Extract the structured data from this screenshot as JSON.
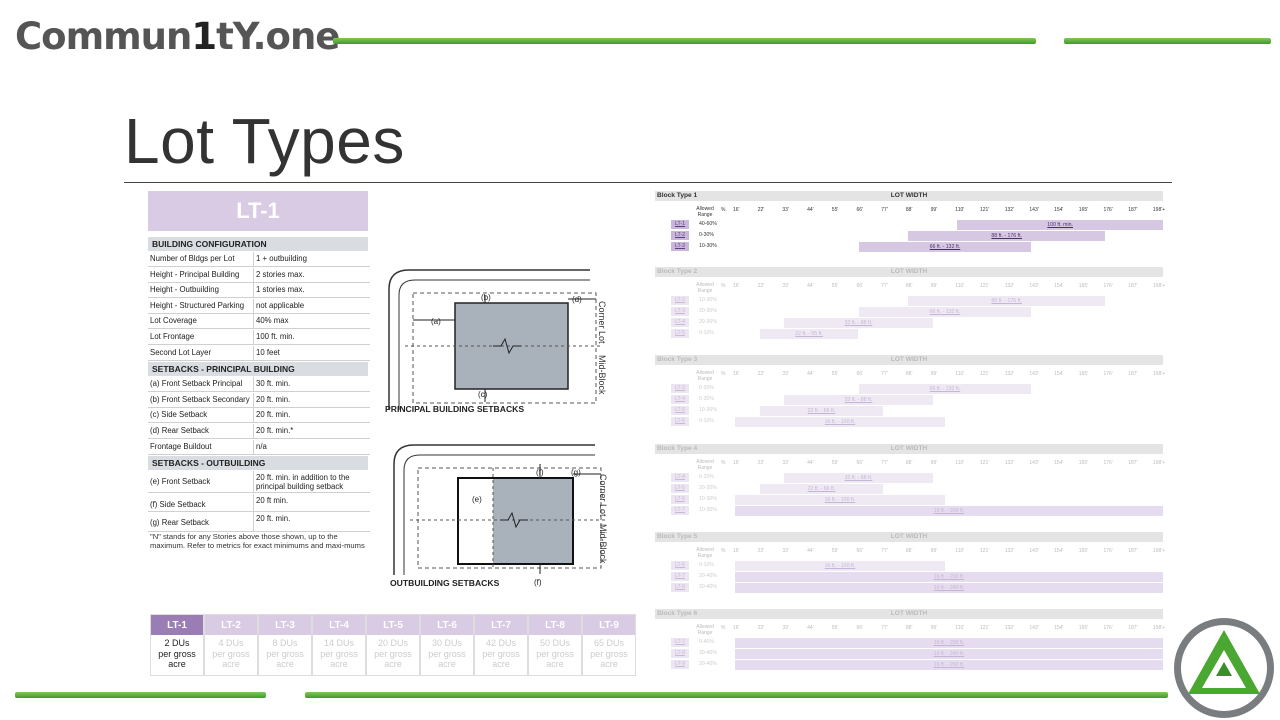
{
  "header": {
    "logo_text_a": "Commun",
    "logo_text_b": "1",
    "logo_text_c": "tY.one",
    "title": "Lot Types"
  },
  "colors": {
    "accent_green": "#4aa832",
    "lavender": "#d9cbe3",
    "purple": "#9b7db5",
    "section_gray": "#d9dde2"
  },
  "lot_table": {
    "title": "LT-1",
    "building_config": {
      "heading": "BUILDING CONFIGURATION",
      "rows": [
        {
          "k": "Number of Bldgs per Lot",
          "v": "1 + outbuilding"
        },
        {
          "k": "Height - Principal Building",
          "v": "2 stories max."
        },
        {
          "k": "Height - Outbuilding",
          "v": "1 stories max."
        },
        {
          "k": "Height - Structured Parking",
          "v": "not applicable"
        },
        {
          "k": "Lot Coverage",
          "v": "40% max"
        },
        {
          "k": "Lot Frontage",
          "v": "100 ft. min."
        },
        {
          "k": "Second Lot Layer",
          "v": "10 feet"
        }
      ]
    },
    "setbacks_principal": {
      "heading": "SETBACKS - PRINCIPAL BUILDING",
      "rows": [
        {
          "k": "(a) Front Setback Principal",
          "v": "30 ft. min."
        },
        {
          "k": "(b) Front Setback Secondary",
          "v": "20 ft. min."
        },
        {
          "k": "(c) Side Setback",
          "v": "20 ft. min."
        },
        {
          "k": "(d) Rear Setback",
          "v": "20 ft. min.*"
        },
        {
          "k": "Frontage Buildout",
          "v": "n/a"
        }
      ]
    },
    "setbacks_outbuilding": {
      "heading": "SETBACKS - OUTBUILDING",
      "rows": [
        {
          "k": "(e) Front Setback",
          "v": "20 ft. min. in addition to the principal building setback"
        },
        {
          "k": "(f) Side Setback",
          "v": "20 ft min."
        },
        {
          "k": "(g) Rear Setback",
          "v": "20 ft. min."
        }
      ]
    },
    "note": "\"N\" stands for any Stories above those shown, up to the maximum. Refer to metrics for exact minimums and maxi-mums"
  },
  "diagrams": {
    "principal": {
      "caption": "PRINCIPAL BUILDING SETBACKS",
      "a": "(a)",
      "b": "(b)",
      "c": "(c)",
      "d": "(d)",
      "corner": "Corner Lot",
      "mid": "Mid-Block"
    },
    "outbuilding": {
      "caption": "OUTBUILDING SETBACKS",
      "e": "(e)",
      "f1": "(f)",
      "f2": "(f)",
      "g": "(g)",
      "corner": "Corner Lot",
      "mid": "Mid-Block"
    }
  },
  "density": [
    {
      "lt": "LT-1",
      "l1": "2 DUs",
      "l2": "per gross",
      "l3": "acre",
      "on": true
    },
    {
      "lt": "LT-2",
      "l1": "4 DUs",
      "l2": "per gross",
      "l3": "acre",
      "on": false
    },
    {
      "lt": "LT-3",
      "l1": "8 DUs",
      "l2": "per gross",
      "l3": "acre",
      "on": false
    },
    {
      "lt": "LT-4",
      "l1": "14 DUs",
      "l2": "per gross",
      "l3": "acre",
      "on": false
    },
    {
      "lt": "LT-5",
      "l1": "20 DUs",
      "l2": "per gross",
      "l3": "acre",
      "on": false
    },
    {
      "lt": "LT-6",
      "l1": "30 DUs",
      "l2": "per gross",
      "l3": "acre",
      "on": false
    },
    {
      "lt": "LT-7",
      "l1": "42 DUs",
      "l2": "per gross",
      "l3": "acre",
      "on": false
    },
    {
      "lt": "LT-8",
      "l1": "50 DUs",
      "l2": "per gross",
      "l3": "acre",
      "on": false
    },
    {
      "lt": "LT-9",
      "l1": "65 DUs",
      "l2": "per gross",
      "l3": "acre",
      "on": false
    }
  ],
  "block_chart": {
    "lot_width_label": "LOT WIDTH",
    "allowed_range_label": "Allowed Range",
    "pct_label": "%",
    "ticks": [
      "16'",
      "22'",
      "33'",
      "44'",
      "55'",
      "66'",
      "77'",
      "88'",
      "99'",
      "110'",
      "121'",
      "132'",
      "143'",
      "154'",
      "165'",
      "176'",
      "187'",
      "198'+"
    ],
    "blocks": [
      {
        "name": "Block Type 1",
        "dim": false,
        "rows": [
          {
            "lt": "LT-1",
            "pct": "40-60%",
            "from": 9,
            "to": 18,
            "label": "100 ft. min."
          },
          {
            "lt": "LT-2",
            "pct": "0-30%",
            "from": 7,
            "to": 15,
            "label": "88 ft. - 176 ft."
          },
          {
            "lt": "LT-3",
            "pct": "10-30%",
            "from": 5,
            "to": 12,
            "label": "66 ft. - 132 ft."
          }
        ]
      },
      {
        "name": "Block Type 2",
        "dim": true,
        "rows": [
          {
            "lt": "LT-2",
            "pct": "10-30%",
            "from": 7,
            "to": 15,
            "label": "88 ft. - 176 ft."
          },
          {
            "lt": "LT-3",
            "pct": "20-30%",
            "from": 5,
            "to": 12,
            "label": "66 ft. - 132 ft."
          },
          {
            "lt": "LT-4",
            "pct": "20-30%",
            "from": 2,
            "to": 8,
            "label": "33 ft. - 88 ft."
          },
          {
            "lt": "LT-5",
            "pct": "0-10%",
            "from": 1,
            "to": 5,
            "label": "22 ft. - 55 ft."
          }
        ]
      },
      {
        "name": "Block Type 3",
        "dim": true,
        "rows": [
          {
            "lt": "LT-3",
            "pct": "0-20%",
            "from": 5,
            "to": 12,
            "label": "66 ft. - 132 ft."
          },
          {
            "lt": "LT-4",
            "pct": "0-30%",
            "from": 2,
            "to": 8,
            "label": "33 ft. - 88 ft."
          },
          {
            "lt": "LT-5",
            "pct": "10-30%",
            "from": 1,
            "to": 6,
            "label": "22 ft. - 66 ft."
          },
          {
            "lt": "LT-6",
            "pct": "0-10%",
            "from": 0,
            "to": 8.5,
            "label": "16 ft. - 100 ft."
          }
        ]
      },
      {
        "name": "Block Type 4",
        "dim": true,
        "rows": [
          {
            "lt": "LT-4",
            "pct": "0-20%",
            "from": 2,
            "to": 8,
            "label": "33 ft. - 88 ft."
          },
          {
            "lt": "LT-5",
            "pct": "20-30%",
            "from": 1,
            "to": 6,
            "label": "22 ft. - 66 ft."
          },
          {
            "lt": "LT-6",
            "pct": "10-30%",
            "from": 0,
            "to": 8.5,
            "label": "16 ft. - 100 ft."
          },
          {
            "lt": "LT-7",
            "pct": "10-30%",
            "from": 0,
            "to": 18,
            "label": "16 ft. - 200 ft."
          }
        ]
      },
      {
        "name": "Block Type 5",
        "dim": true,
        "rows": [
          {
            "lt": "LT-6",
            "pct": "0-10%",
            "from": 0,
            "to": 8.5,
            "label": "16 ft. - 100 ft."
          },
          {
            "lt": "LT-7",
            "pct": "20-40%",
            "from": 0,
            "to": 18,
            "label": "16 ft. - 200 ft."
          },
          {
            "lt": "LT-8",
            "pct": "20-40%",
            "from": 0,
            "to": 18,
            "label": "16 ft. - 240 ft."
          }
        ]
      },
      {
        "name": "Block Type 6",
        "dim": true,
        "rows": [
          {
            "lt": "LT-7",
            "pct": "0-40%",
            "from": 0,
            "to": 18,
            "label": "16 ft. - 200 ft."
          },
          {
            "lt": "LT-8",
            "pct": "20-40%",
            "from": 0,
            "to": 18,
            "label": "16 ft. - 240 ft."
          },
          {
            "lt": "LT-9",
            "pct": "20-40%",
            "from": 0,
            "to": 18,
            "label": "16 ft. - 260 ft."
          }
        ]
      }
    ]
  }
}
